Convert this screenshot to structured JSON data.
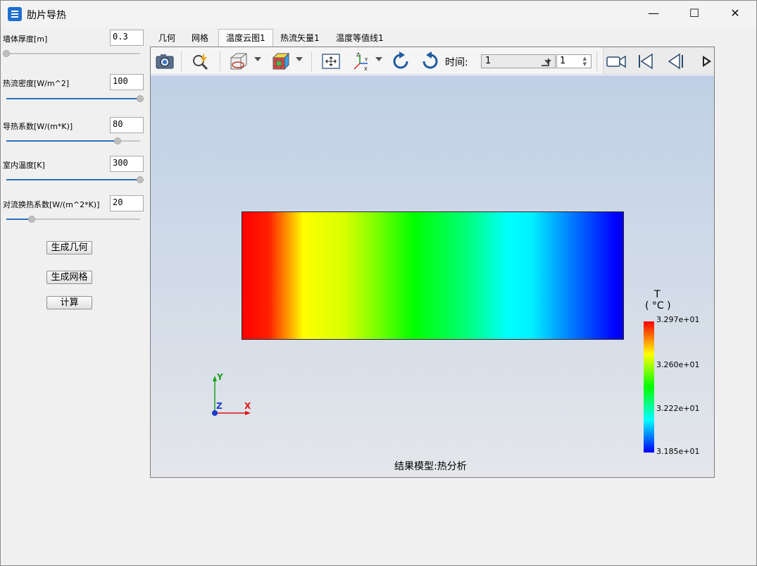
{
  "window": {
    "title": "肋片导热",
    "controls": {
      "minimize": "—",
      "maximize": "☐",
      "close": "✕"
    }
  },
  "params": [
    {
      "label": "墙体厚度[m]",
      "value": "0.3",
      "slider_fraction": 0.0
    },
    {
      "label": "热流密度[W/m^2]",
      "value": "100",
      "slider_fraction": 1.0
    },
    {
      "label": "导热系数[W/(m*K)]",
      "value": "80",
      "slider_fraction": 0.83
    },
    {
      "label": "室内温度[K]",
      "value": "300",
      "slider_fraction": 1.0
    },
    {
      "label": "对流换热系数[W/(m^2*K)]",
      "value": "20",
      "slider_fraction": 0.19
    }
  ],
  "buttons": {
    "generate_geometry": "生成几何",
    "generate_mesh": "生成网格",
    "compute": "计算"
  },
  "tabs": [
    "几何",
    "网格",
    "温度云图1",
    "热流矢量1",
    "温度等值线1"
  ],
  "active_tab": "温度云图1",
  "toolbar": {
    "time_label": "时间:",
    "time_value": "1",
    "step_value": "1",
    "icons": [
      "camera-icon",
      "zoom-icon",
      "clip-plane-icon",
      "color-cube-icon",
      "fit-view-icon",
      "axes-icon",
      "rotate-cw-icon",
      "rotate-ccw-icon",
      "video-icon",
      "first-frame-icon",
      "prev-frame-icon",
      "next-frame-icon"
    ]
  },
  "view": {
    "axes": {
      "x": "X",
      "y": "Y",
      "z": "Z"
    },
    "legend": {
      "title": "T",
      "unit": "( °C )",
      "max": "3.297e+01",
      "mid_high": "3.260e+01",
      "mid_low": "3.222e+01",
      "min": "3.185e+01"
    },
    "caption": "结果模型:热分析",
    "colors": {
      "hot": "#ff0000",
      "cold": "#0000ff"
    }
  }
}
